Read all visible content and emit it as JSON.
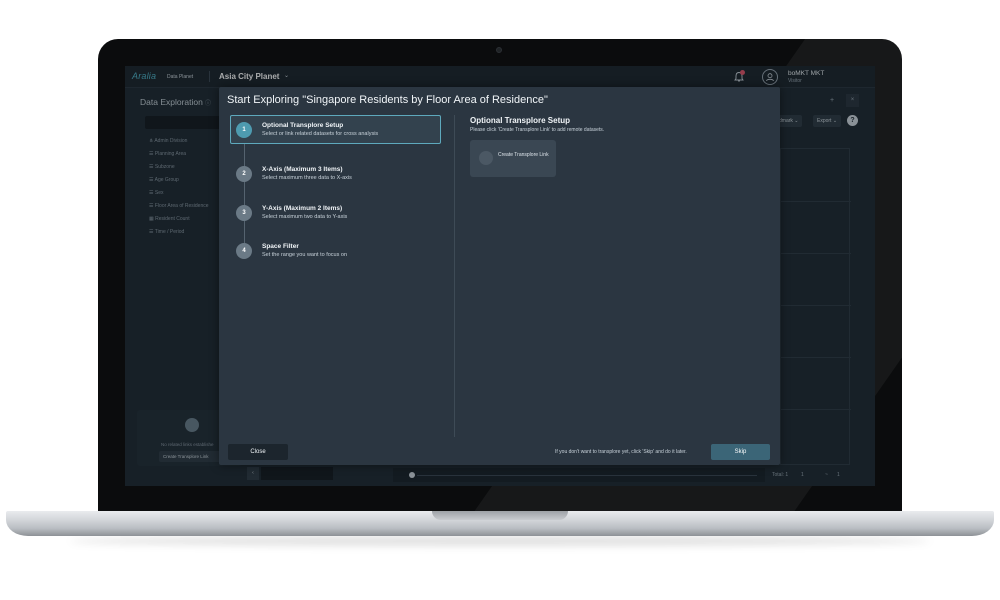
{
  "app": {
    "logo_text": "Aralia",
    "logo_sub": "Data Planet",
    "project": "Asia City Planet",
    "project_chevron": "⌄",
    "user_name": "boMKT MKT",
    "user_role": "Visitor"
  },
  "left_panel": {
    "title": "Data Exploration",
    "info_icon": "ⓘ",
    "items": [
      {
        "icon": "⋔",
        "label": "Admin Division"
      },
      {
        "icon": "☰",
        "label": "Planning Area"
      },
      {
        "icon": "☰",
        "label": "Subzone"
      },
      {
        "icon": "☰",
        "label": "Age Group"
      },
      {
        "icon": "☰",
        "label": "Sex"
      },
      {
        "icon": "☰",
        "label": "Floor Area of Residence"
      },
      {
        "icon": "▦",
        "label": "Resident Count"
      },
      {
        "icon": "☰",
        "label": "Time / Period"
      }
    ],
    "no_links_text": "No related links establishe",
    "create_link_label": "Create Transplore Link",
    "collapse_label": "‹"
  },
  "right_panel": {
    "plus": "+",
    "close": "×",
    "bookmark_label": "dmark ⌄",
    "export_label": "Export ⌄",
    "help": "?",
    "total_label": "Total: 1",
    "range_start": "1",
    "range_sep": "~",
    "range_end": "1"
  },
  "modal": {
    "title": "Start Exploring \"Singapore Residents by Floor Area of Residence\"",
    "steps": [
      {
        "num": "1",
        "title": "Optional Transplore Setup",
        "desc": "Select or link related datasets for cross analysis"
      },
      {
        "num": "2",
        "title": "X-Axis (Maximum 3 Items)",
        "desc": "Select maximum three data to X-axis"
      },
      {
        "num": "3",
        "title": "Y-Axis (Maximum 2 Items)",
        "desc": "Select maximum two data to Y-axis"
      },
      {
        "num": "4",
        "title": "Space Filter",
        "desc": "Set the range you want to focus on"
      }
    ],
    "section_title": "Optional Transplore Setup",
    "section_desc": "Please click 'Create Transplore Link' to add remote datasets.",
    "create_card_label": "Create Transplore Link",
    "close_label": "Close",
    "skip_note": "If you don't want to transplore yet, click 'Skip' and do it later.",
    "skip_label": "Skip"
  },
  "colors": {
    "accent": "#4e9bb0",
    "skip_button": "#3b6577",
    "notification_dot": "#e0556b"
  }
}
